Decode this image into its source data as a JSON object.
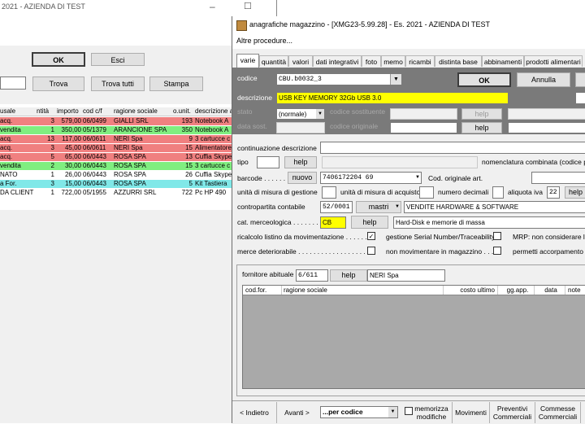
{
  "bg_window": {
    "title": "2021 - AZIENDA DI TEST",
    "buttons": {
      "ok": "OK",
      "esci": "Esci",
      "trova": "Trova",
      "trova_tutti": "Trova tutti",
      "stampa": "Stampa"
    },
    "columns": [
      "usale",
      "ntità",
      "importo",
      "cod c/f",
      "ragione sociale",
      "o.unit.",
      "descrizione a"
    ],
    "rows": [
      {
        "c0": "acq.",
        "c1": "3",
        "c2": "579,00",
        "c3": "06/0499",
        "c4": "GIALLI SRL",
        "c5": "193",
        "c6": "Notebook A",
        "color": "#f08080"
      },
      {
        "c0": "vendita",
        "c1": "1",
        "c2": "350,00",
        "c3": "05/1379",
        "c4": "ARANCIONE SPA",
        "c5": "350",
        "c6": "Notebook A",
        "color": "#80ee80"
      },
      {
        "c0": "acq.",
        "c1": "13",
        "c2": "117,00",
        "c3": "06/0611",
        "c4": "NERI Spa",
        "c5": "9",
        "c6": "3 cartucce c",
        "color": "#f08080"
      },
      {
        "c0": "acq.",
        "c1": "3",
        "c2": "45,00",
        "c3": "06/0611",
        "c4": "NERI Spa",
        "c5": "15",
        "c6": "Alimentatore",
        "color": "#f08080"
      },
      {
        "c0": "acq.",
        "c1": "5",
        "c2": "65,00",
        "c3": "06/0443",
        "c4": "ROSA SPA",
        "c5": "13",
        "c6": "Cuffia Skype",
        "color": "#f08080"
      },
      {
        "c0": "vendita",
        "c1": "2",
        "c2": "30,00",
        "c3": "06/0443",
        "c4": "ROSA SPA",
        "c5": "15",
        "c6": "3 cartucce c",
        "color": "#80ee80"
      },
      {
        "c0": "NATO",
        "c1": "1",
        "c2": "26,00",
        "c3": "06/0443",
        "c4": "ROSA SPA",
        "c5": "26",
        "c6": "Cuffia Skype",
        "color": "#ffffff"
      },
      {
        "c0": "a For.",
        "c1": "3",
        "c2": "15,00",
        "c3": "06/0443",
        "c4": "ROSA SPA",
        "c5": "5",
        "c6": "Kit Tastiera",
        "color": "#80e8e8"
      },
      {
        "c0": "DA CLIENTE",
        "c1": "1",
        "c2": "722,00",
        "c3": "05/1955",
        "c4": "AZZURRI SRL",
        "c5": "722",
        "c6": "Pc HP 490",
        "color": "#ffffff"
      }
    ]
  },
  "fg_window": {
    "title": "anagrafiche magazzino - [XMG23-5.99.28] - Es. 2021 - AZIENDA DI TEST",
    "menu": "Altre procedure...",
    "tabs": [
      "varie",
      "quantità",
      "valori",
      "dati integrativi",
      "foto",
      "memo",
      "ricambi",
      "distinta base",
      "abbinamenti",
      "prodotti alimentari"
    ],
    "codice_label": "codice",
    "codice_value": "CBU.b0032_3",
    "ok": "OK",
    "annulla": "Annulla",
    "descrizione_label": "descrizione",
    "descrizione_value": "USB KEY MEMORY 32Gb USB 3.0",
    "stato_label": "stato",
    "stato_value": "(normale)",
    "codice_sostituente": "codice sostituente",
    "data_sost": "data sost.",
    "codice_originale": "codice originale",
    "help": "help",
    "continuazione": "continuazione descrizione",
    "tipo": "tipo",
    "nomenclatura": "nomenclatura combinata (codice pe",
    "barcode": "barcode . . . . . . . .",
    "nuovo": "nuovo",
    "barcode_value": "7406172204 69",
    "cod_orig_art": "Cod. originale art.",
    "um_gestione": "unità di misura di gestione",
    "um_acquisto": "unità di misura di acquisto",
    "numero_decimali": "numero decimali",
    "aliquota_iva": "aliquota iva",
    "aliquota_value": "22",
    "contropartita": "contropartita contabile",
    "contropartita_code": "52/0001",
    "mastri": "mastri",
    "contropartita_desc": "VENDITE HARDWARE & SOFTWARE",
    "cat_merc": "cat. merceologica . . . . . . . .",
    "cat_code": "CB",
    "cat_desc": "Hard-Disk e memorie di massa",
    "ricalcolo": "ricalcolo listino da movimentazione . . . . . . .",
    "gestione_serial": "gestione Serial Number/Traceability",
    "mrp": "MRP: non considerare la",
    "merce_det": "merce deteriorabile . . . . . . . . . . . . . . . . . . . .",
    "non_movimentare": "non movimentare in magazzino . . . .",
    "permetti": "permetti accorpamento su",
    "fornitore_label": "fornitore abituale",
    "fornitore_code": "6/611",
    "fornitore_name": "NERI Spa",
    "grid_cols": [
      "cod.for.",
      "ragione sociale",
      "costo ultimo",
      "gg.app.",
      "data",
      "note"
    ],
    "bottom": {
      "indietro": "< Indietro",
      "avanti": "Avanti >",
      "per_codice": "...per codice",
      "memorizza": "memorizza modifiche",
      "movimenti": "Movimenti",
      "preventivi": "Preventivi Commerciali",
      "commesse": "Commesse Commerciali"
    }
  },
  "colors": {
    "accent": "#7a7a7a",
    "yellow": "#ffff00",
    "tab_bg": "#f0f0f0"
  }
}
